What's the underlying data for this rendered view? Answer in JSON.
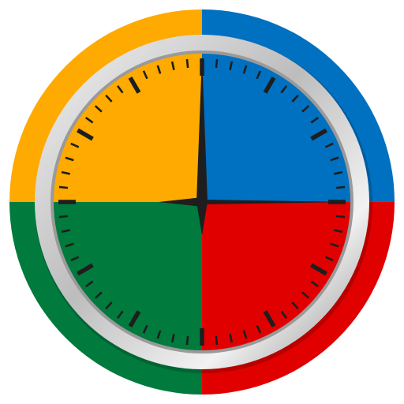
{
  "icon": {
    "name": "four-color-clock-icon",
    "colors": {
      "top_left": "#FFAA00",
      "top_right": "#0070C0",
      "bottom_left": "#007A3D",
      "bottom_right": "#E00000",
      "bezel_light": "#F2F2F2",
      "bezel_mid": "#BDBDBD",
      "bezel_dark": "#8A8A8A",
      "ticks": "#1E1E1E",
      "hands": "#1E1E1E"
    },
    "time": {
      "hour": 9,
      "minute": 0,
      "second": 15
    }
  }
}
